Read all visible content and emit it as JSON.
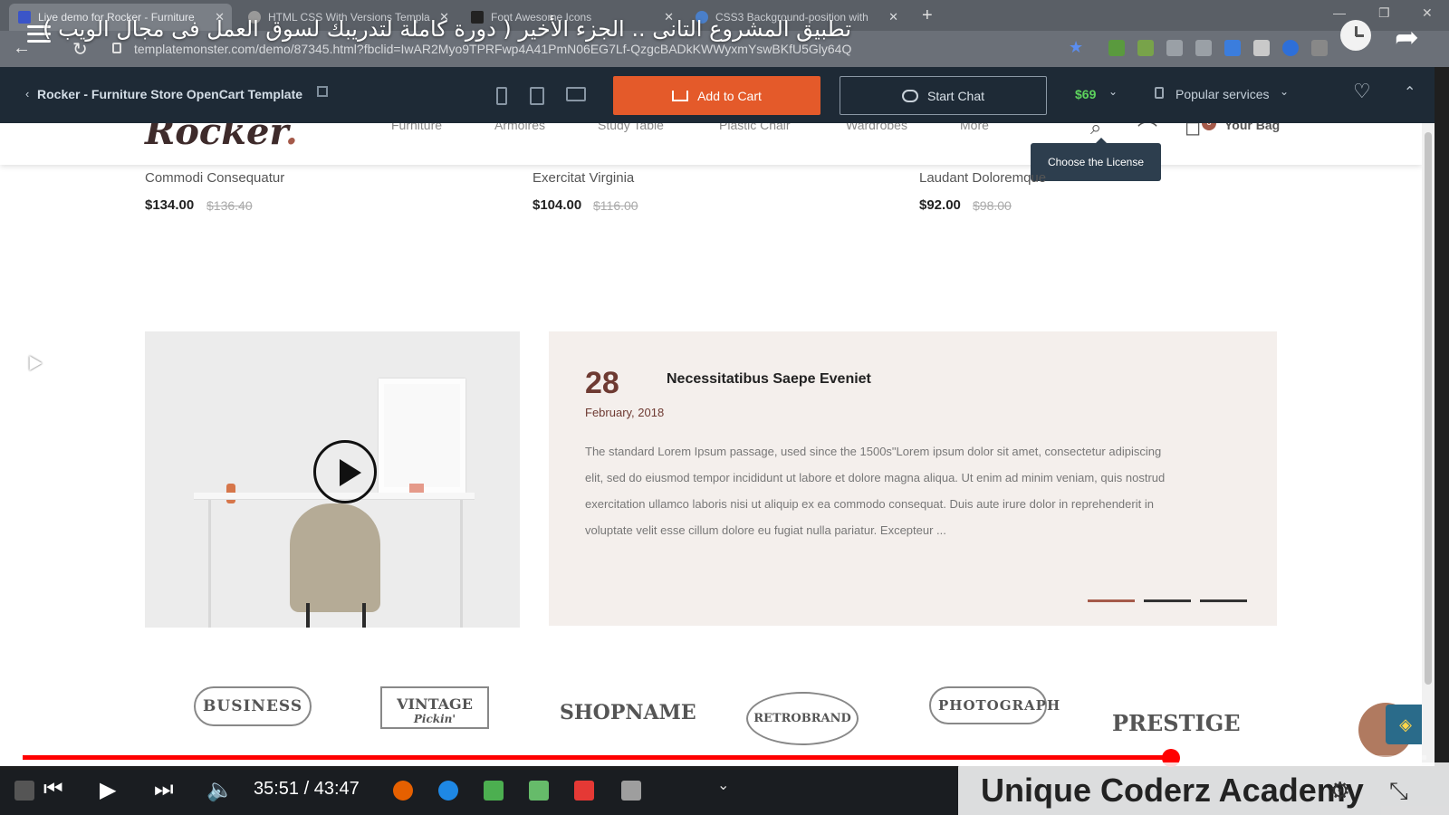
{
  "browser": {
    "tabs": [
      {
        "title": "Live demo for Rocker - Furniture",
        "active": true,
        "icon": "template-monster-icon"
      },
      {
        "title": "HTML CSS With Versions Templa",
        "active": false,
        "icon": "globe-icon"
      },
      {
        "title": "Font Awesome Icons",
        "active": false,
        "icon": "font-awesome-icon"
      },
      {
        "title": "CSS3 Background-position with",
        "active": false,
        "icon": "w3-icon"
      }
    ],
    "new_tab_label": "+",
    "url": "templatemonster.com/demo/87345.html?fbclid=IwAR2Myo9TPRFwp4A41PmN06EG7Lf-QzgcBADkKWWyxmYswBKfU5Gly64Q"
  },
  "video": {
    "title": "تطبيق المشروع التانى .. الجزء الأخير ( دورة كاملة لتدريبك لسوق العمل فى مجال الويب )",
    "current_time": "35:51",
    "duration": "43:47",
    "time_display": "35:51 / 43:47",
    "progress": 0.818,
    "watermark": "Unique Coderz Academy"
  },
  "tm_bar": {
    "back_label": "‹",
    "product_title": "Rocker - Furniture Store OpenCart Template",
    "add_to_cart": "Add to Cart",
    "start_chat": "Start Chat",
    "price": "$69",
    "popular_services": "Popular services",
    "tooltip": "Choose the License",
    "accent": "#e45a2a"
  },
  "store": {
    "logo_text": "Rocker",
    "logo_dot": ".",
    "menu": [
      "Furniture",
      "Armoires",
      "Study Table",
      "Plastic Chair",
      "Wardrobes",
      "More"
    ],
    "bag_count": "0",
    "bag_label": "Your Bag",
    "products": [
      {
        "name": "Commodi Consequatur",
        "price": "$134.00",
        "old_price": "$136.40"
      },
      {
        "name": "Exercitat Virginia",
        "price": "$104.00",
        "old_price": "$116.00"
      },
      {
        "name": "Laudant Doloremque",
        "price": "$92.00",
        "old_price": "$98.00"
      }
    ],
    "blog": {
      "day": "28",
      "month_year": "February, 2018",
      "title": "Necessitatibus Saepe Eveniet",
      "excerpt": "The standard Lorem Ipsum passage, used since the 1500s\"Lorem ipsum dolor sit amet, consectetur adipiscing elit, sed do eiusmod tempor incididunt ut labore et dolore magna aliqua. Ut enim ad minim veniam, quis nostrud exercitation ullamco laboris nisi ut aliquip ex ea commodo consequat. Duis aute irure dolor in reprehenderit in voluptate velit esse cillum dolore eu fugiat nulla pariatur. Excepteur ..."
    },
    "brands": [
      "BUSINESS",
      "VINTAGE",
      "SHOPNAME",
      "RETROBRAND",
      "PHOTOGRAPH",
      "PRESTIGE"
    ],
    "brand_sub": "Pickin'"
  }
}
